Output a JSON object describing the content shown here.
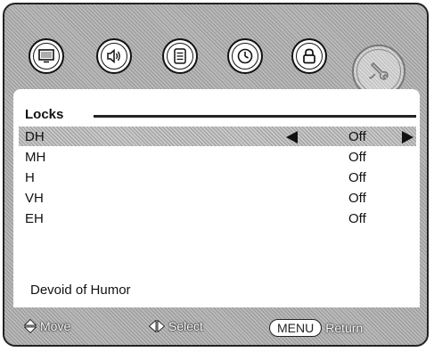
{
  "menu": {
    "tabs": [
      {
        "icon": "picture-icon"
      },
      {
        "icon": "sound-icon"
      },
      {
        "icon": "channel-list-icon"
      },
      {
        "icon": "clock-icon"
      },
      {
        "icon": "lock-icon"
      },
      {
        "icon": "setup-wrench-icon",
        "active": true
      }
    ],
    "section_title": "Locks",
    "rows": [
      {
        "label": "DH",
        "value": "Off",
        "selected": true
      },
      {
        "label": "MH",
        "value": "Off"
      },
      {
        "label": "H",
        "value": "Off"
      },
      {
        "label": "VH",
        "value": "Off"
      },
      {
        "label": "EH",
        "value": "Off"
      }
    ],
    "footer_text": "Devoid of Humor"
  },
  "hints": {
    "move": "Move",
    "select": "Select",
    "menu_key": "MENU",
    "return": "Return"
  }
}
